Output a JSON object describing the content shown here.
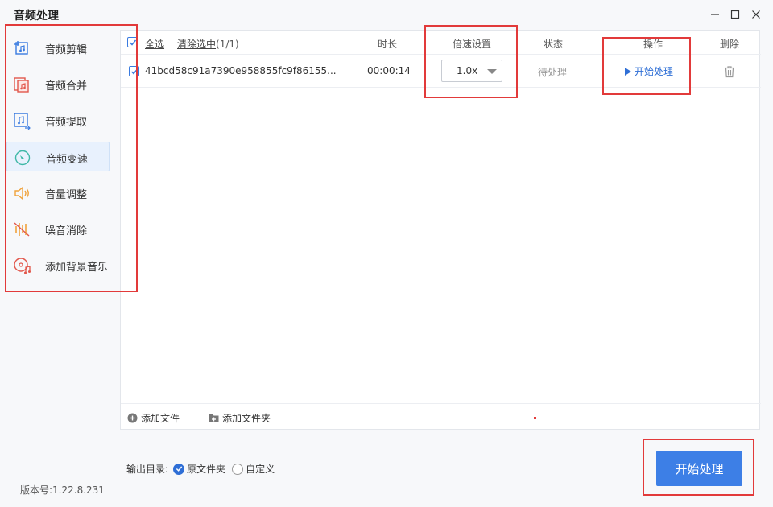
{
  "window": {
    "title": "音频处理",
    "controls": [
      "minimize-icon",
      "maximize-icon",
      "close-icon"
    ]
  },
  "sidebar": {
    "items": [
      {
        "label": "音频剪辑",
        "icon": "audio-cut-icon",
        "active": false
      },
      {
        "label": "音频合并",
        "icon": "audio-merge-icon",
        "active": false
      },
      {
        "label": "音频提取",
        "icon": "audio-extract-icon",
        "active": false
      },
      {
        "label": "音频变速",
        "icon": "audio-speed-icon",
        "active": true
      },
      {
        "label": "音量调整",
        "icon": "volume-icon",
        "active": false
      },
      {
        "label": "噪音消除",
        "icon": "noise-reduce-icon",
        "active": false
      },
      {
        "label": "添加背景音乐",
        "icon": "bg-music-icon",
        "active": false
      }
    ]
  },
  "table": {
    "select_all": "全选",
    "clear_selected": "清除选中",
    "selected_count": "(1/1)",
    "headers": {
      "duration": "时长",
      "speed": "倍速设置",
      "status": "状态",
      "action": "操作",
      "delete": "删除"
    },
    "rows": [
      {
        "checked": true,
        "filename": "41bcd58c91a7390e958855fc9f86155...",
        "duration": "00:00:14",
        "speed": "1.0x",
        "status": "待处理",
        "action": "开始处理"
      }
    ]
  },
  "footer": {
    "add_file": "添加文件",
    "add_folder": "添加文件夹"
  },
  "output": {
    "label": "输出目录:",
    "options": [
      "原文件夹",
      "自定义"
    ],
    "selected": "原文件夹"
  },
  "start_button": "开始处理",
  "version": "版本号:1.22.8.231",
  "colors": {
    "accent": "#3d7fe6",
    "link": "#2f6fd6",
    "highlight": "#e23a3a",
    "active_bg": "#e8f1fd"
  }
}
